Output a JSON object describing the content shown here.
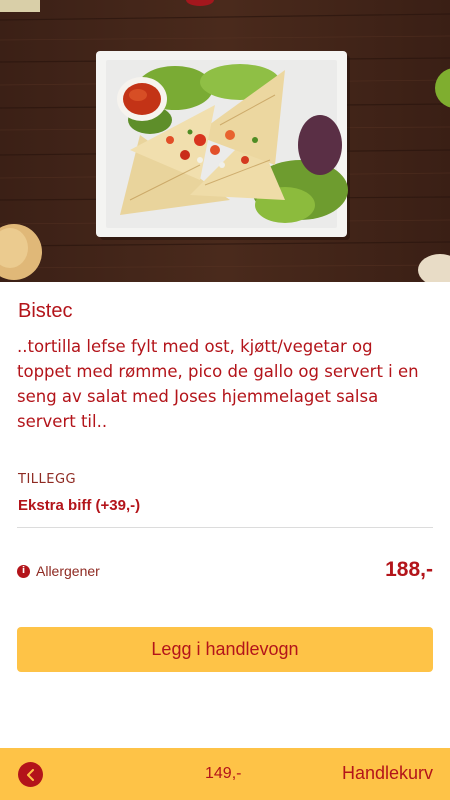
{
  "product": {
    "image_alt": "quesadilla-photo",
    "title": "Bistec",
    "description": "..tortilla lefse fylt med ost, kjøtt/vegetar og toppet med rømme, pico de gallo og servert i en seng av salat med Joses hjemmelaget salsa servert til..",
    "price": "188,-"
  },
  "addons": {
    "heading": "TILLEGG",
    "items": [
      {
        "label": "Ekstra biff (+39,-)"
      }
    ]
  },
  "allergen": {
    "icon": "info-icon",
    "glyph": "i",
    "label": "Allergener"
  },
  "actions": {
    "add_to_cart_label": "Legg i handlevogn"
  },
  "footer": {
    "back_icon": "chevron-left-icon",
    "cart_total": "149,-",
    "cart_label": "Handlekurv"
  },
  "colors": {
    "brand_red": "#b3141a",
    "accent_yellow": "#fec347",
    "divider": "#dcdcdc"
  }
}
